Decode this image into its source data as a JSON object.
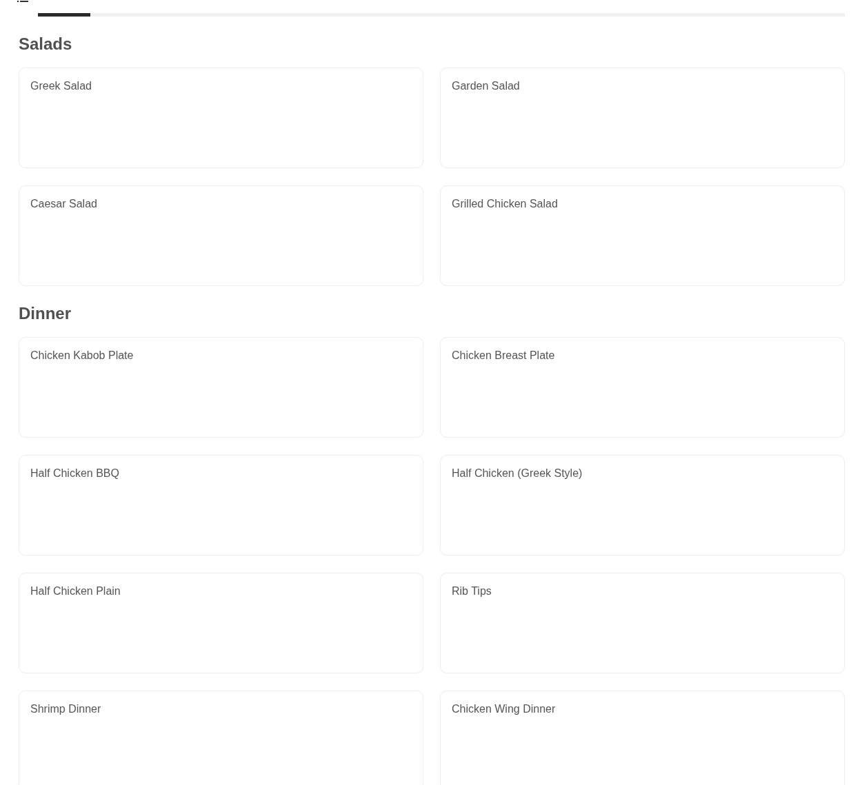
{
  "tabs": [
    {
      "selected": true
    }
  ],
  "sections": [
    {
      "title": "Salads",
      "items": [
        {
          "name": "Greek Salad"
        },
        {
          "name": "Garden Salad"
        },
        {
          "name": "Caesar Salad"
        },
        {
          "name": "Grilled Chicken Salad"
        }
      ]
    },
    {
      "title": "Dinner",
      "items": [
        {
          "name": "Chicken Kabob Plate"
        },
        {
          "name": "Chicken Breast Plate"
        },
        {
          "name": "Half Chicken BBQ"
        },
        {
          "name": "Half Chicken (Greek Style)"
        },
        {
          "name": "Half Chicken Plain"
        },
        {
          "name": "Rib Tips"
        },
        {
          "name": "Shrimp Dinner"
        },
        {
          "name": "Chicken Wing Dinner"
        }
      ]
    }
  ]
}
